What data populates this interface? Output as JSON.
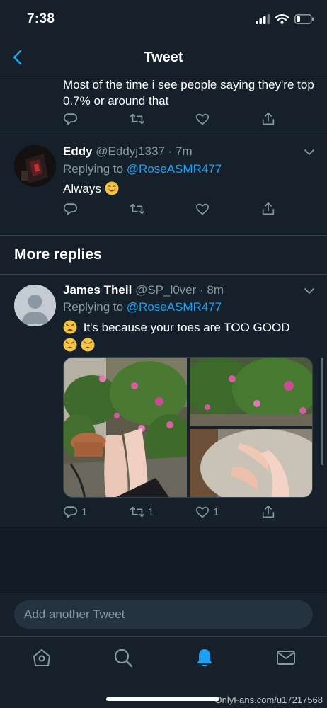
{
  "status_bar": {
    "time": "7:38"
  },
  "header": {
    "title": "Tweet"
  },
  "previous_tweet": {
    "text": "Most of the time i see people saying they're top 0.7% or around that",
    "actions": {
      "reply": "",
      "retweet": "",
      "like": "",
      "share": ""
    }
  },
  "reply_eddy": {
    "name": "Eddy",
    "handle": "@Eddyj1337",
    "time": "7m",
    "replying_prefix": "Replying to",
    "replying_to": "@RoseASMR477",
    "text": "Always"
  },
  "section": {
    "more_replies": "More replies"
  },
  "reply_james": {
    "name": "James Theil",
    "handle": "@SP_l0ver",
    "time": "8m",
    "replying_prefix": "Replying to",
    "replying_to": "@RoseASMR477",
    "text": "It's because your toes are TOO GOOD",
    "counts": {
      "reply": "1",
      "retweet": "1",
      "like": "1"
    }
  },
  "composer": {
    "placeholder": "Add another Tweet"
  },
  "watermark": "OnlyFans.com/u17217568",
  "colors": {
    "background": "#15202b",
    "accent": "#1da1f2",
    "secondary_text": "#8899a6",
    "divider": "#38444d"
  },
  "icons": [
    "back-arrow-icon",
    "chevron-down-icon",
    "reply-icon",
    "retweet-icon",
    "like-icon",
    "share-icon",
    "home-icon",
    "search-icon",
    "notifications-icon",
    "messages-icon"
  ]
}
